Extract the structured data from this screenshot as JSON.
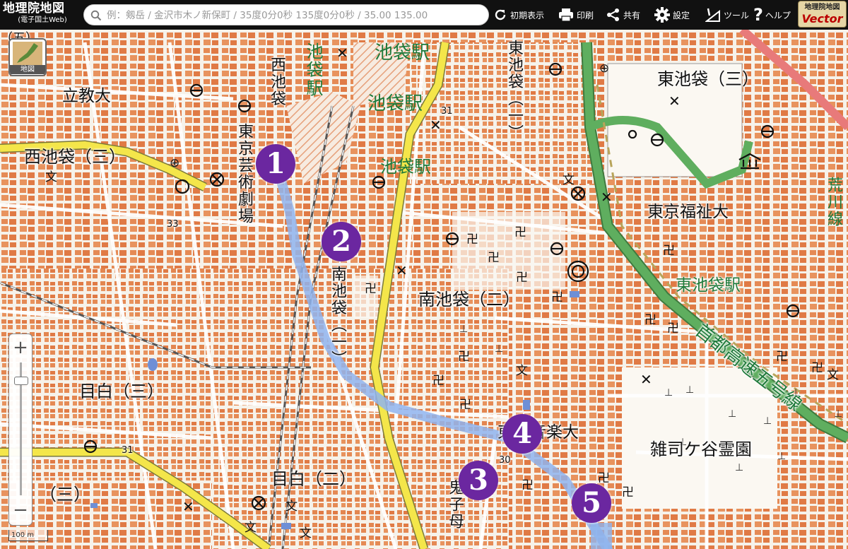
{
  "brand": {
    "title": "地理院地図",
    "subtitle": "(電子国土Web)"
  },
  "search": {
    "placeholder": "例：剱岳 / 金沢市木ノ新保町 / 35度0分0秒 135度0分0秒 / 35.00 135.00"
  },
  "toolbar": {
    "reset_label": "初期表示",
    "print_label": "印刷",
    "share_label": "共有",
    "settings_label": "設定",
    "tools_label": "ツール",
    "help_label": "ヘルプ"
  },
  "vector_logo": {
    "line1": "地理院地図",
    "line2": "Vector"
  },
  "layer_button": {
    "label": "地図"
  },
  "zoom": {
    "in": "+",
    "out": "−"
  },
  "scale_bar": {
    "label": "100 m"
  },
  "route": {
    "color": "#8fb4ee"
  },
  "markers": [
    {
      "num": "1"
    },
    {
      "num": "2"
    },
    {
      "num": "3"
    },
    {
      "num": "4"
    },
    {
      "num": "5"
    }
  ],
  "map_labels": {
    "ikebukuro_station_1": "池袋駅",
    "ikebukuro_station_2": "池袋駅",
    "ikebukuro_station_3": "池袋駅",
    "ikebukuro_station_vertical": "池袋駅",
    "nishi_ikebukuro": "西池袋",
    "nishi_ikebukuro_3": "西池袋（三）",
    "rikkyo_univ": "立教大",
    "tokyo_geijutsu_gekijo": "東京芸術劇場",
    "higashi_ikebukuro_v": "東池袋（一）",
    "higashi_ikebukuro_3": "東池袋（三）",
    "tokyo_fukushi_univ": "東京福祉大",
    "higashi_ikebukuro_station": "東池袋駅",
    "shuto_expressway": "首都高速五号線",
    "minami_ikebukuro_v": "南池袋（一）",
    "minami_ikebukuro_2": "南池袋（二）",
    "mejiro_3": "目白（三）",
    "mejiro_2": "目白（二）",
    "ongaku_univ": "東京音楽大",
    "zoshigaya_cemetery": "雑司ケ谷霊園",
    "kishimojin": "鬼子母",
    "left_3": "（三）",
    "top_left_5": "（五）",
    "route_31_a": "31",
    "route_31_b": "31",
    "route_33": "33",
    "arakawa_line": "荒川線",
    "elev_30": "30"
  }
}
